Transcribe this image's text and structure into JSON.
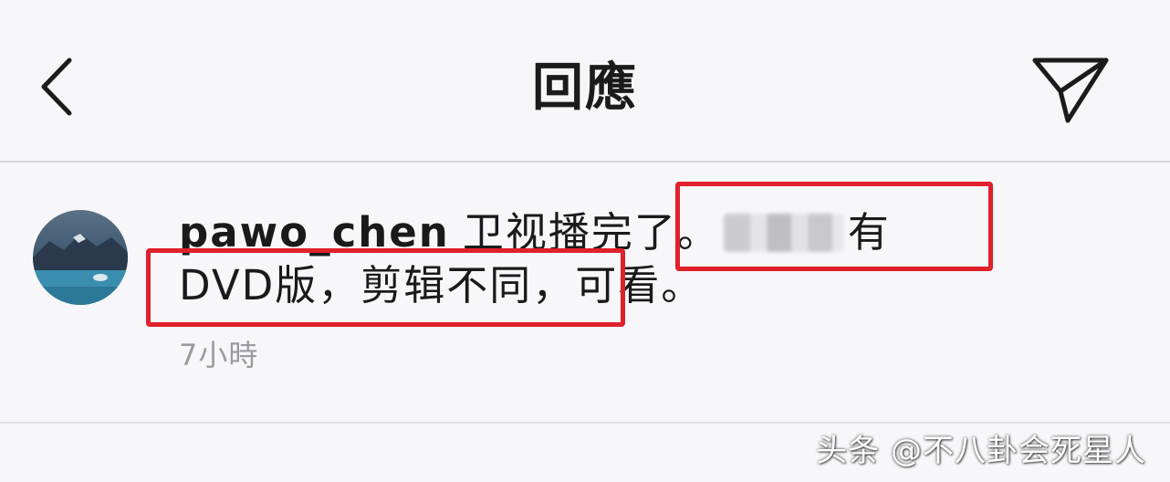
{
  "header": {
    "title": "回應",
    "back_icon": "chevron-left-icon",
    "send_icon": "paper-plane-icon"
  },
  "comment": {
    "username": "pawo_chen",
    "text_part1": "卫视播完了。",
    "text_part2": "有DVD版，剪辑不同，可看。",
    "timestamp": "7小時"
  },
  "annotation": {
    "highlight_color": "#e0202a"
  },
  "watermark": "头条 @不八卦会死星人"
}
